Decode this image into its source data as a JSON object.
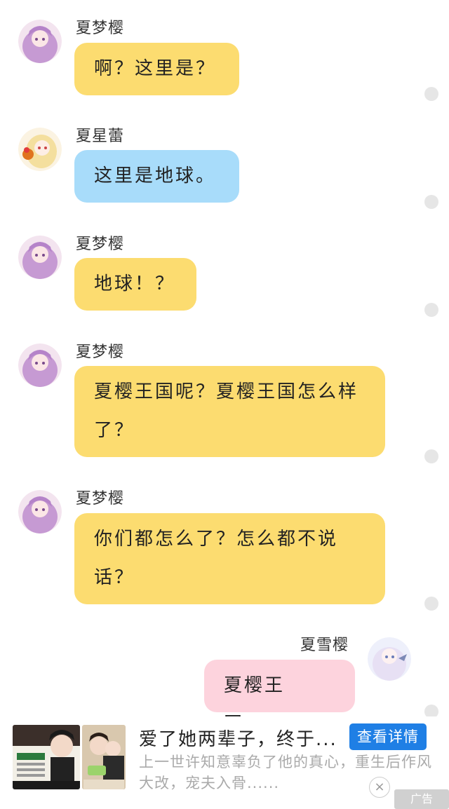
{
  "messages": [
    {
      "name": "夏梦樱",
      "text": "啊？这里是？",
      "side": "left",
      "color": "yellow",
      "avatar": "purple"
    },
    {
      "name": "夏星蕾",
      "text": "这里是地球。",
      "side": "left",
      "color": "blue",
      "avatar": "blonde"
    },
    {
      "name": "夏梦樱",
      "text": "地球！？",
      "side": "left",
      "color": "yellow",
      "avatar": "purple"
    },
    {
      "name": "夏梦樱",
      "text": "夏樱王国呢？夏樱王国怎么样了？",
      "side": "left",
      "color": "yellow",
      "avatar": "purple"
    },
    {
      "name": "夏梦樱",
      "text": "你们都怎么了？怎么都不说话？",
      "side": "left",
      "color": "yellow",
      "avatar": "purple"
    },
    {
      "name": "夏雪樱",
      "text": "夏樱王国……",
      "side": "right",
      "color": "pink",
      "avatar": "white"
    }
  ],
  "ad": {
    "title": "爱了她两辈子，终于...",
    "button": "查看详情",
    "description": "上一世许知意辜负了他的真心，重生后作风大改，宠夫入骨......",
    "close": "×",
    "tag": "广告"
  },
  "colors": {
    "yellow": "#fcdc70",
    "blue": "#a8dcfa",
    "pink": "#fdd3dd",
    "ad_button": "#1f7fe5"
  }
}
